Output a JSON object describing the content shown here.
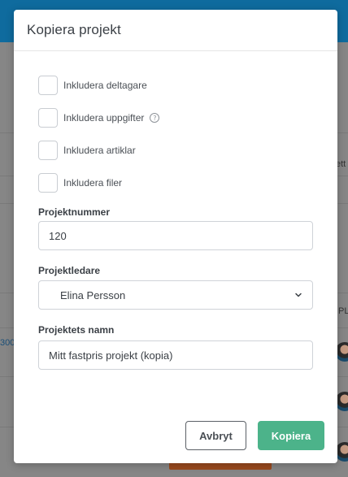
{
  "modal": {
    "title": "Kopiera projekt",
    "options": [
      {
        "label": "Inkludera deltagare",
        "checked": false,
        "help": false
      },
      {
        "label": "Inkludera uppgifter",
        "checked": false,
        "help": true
      },
      {
        "label": "Inkludera artiklar",
        "checked": false,
        "help": false
      },
      {
        "label": "Inkludera filer",
        "checked": false,
        "help": false
      }
    ],
    "help_glyph": "?",
    "project_number": {
      "label": "Projektnummer",
      "value": "120"
    },
    "project_lead": {
      "label": "Projektledare",
      "value": "Elina Persson"
    },
    "project_name": {
      "label": "Projektets namn",
      "value": "Mitt fastpris projekt (kopia)"
    },
    "buttons": {
      "cancel": "Avbryt",
      "confirm": "Kopiera"
    }
  },
  "background": {
    "right_header_fragment": "ett",
    "right_col_fragment": "PL",
    "left_link_fragment": "300"
  },
  "colors": {
    "primary": "#4cb38a",
    "topbar": "#0f6b9e",
    "overlay": "#7f7f7f"
  },
  "icons": {
    "help": "question-circle-icon",
    "dropdown": "chevron-down-icon"
  }
}
